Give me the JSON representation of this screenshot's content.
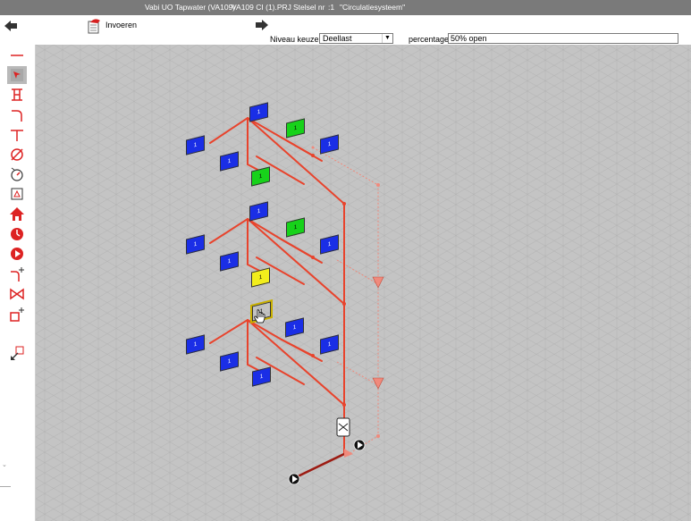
{
  "window": {
    "app": "Vabi UO Tapwater (VA109)",
    "file": "VA109 CI (1).PRJ",
    "stelsel_label": "Stelsel nr",
    "stelsel_value": ":1",
    "stelsel_name": "\"Circulatiesysteem\""
  },
  "toolbar": {
    "invoeren_label": "Invoeren",
    "niveau_label": "Niveau keuze",
    "niveau_value": "Deellast",
    "percentage_label": "percentage",
    "percentage_value": "50% open"
  },
  "sidebar": {
    "tools": [
      "pipe-line-icon",
      "select-tool-icon",
      "tap-point-icon",
      "bend-icon",
      "tee-icon",
      "diameter-icon",
      "valve-dial-icon",
      "boiler-icon",
      "house-icon",
      "clock-icon",
      "pump-icon",
      "add-bend-icon",
      "gate-valve-icon",
      "add-node-icon",
      "export-icon"
    ]
  },
  "diagram": {
    "tap_label": "1",
    "tap_count": 17,
    "colors": {
      "pipe": "#e8432c",
      "return_pipe": "#f08a7c",
      "supply_line": "#9c1b12",
      "blue_tag": "#1a2ee6",
      "green_tag": "#17d21a",
      "yellow_tag": "#f2ee1c",
      "grid_bg": "#c4c4c4"
    }
  }
}
